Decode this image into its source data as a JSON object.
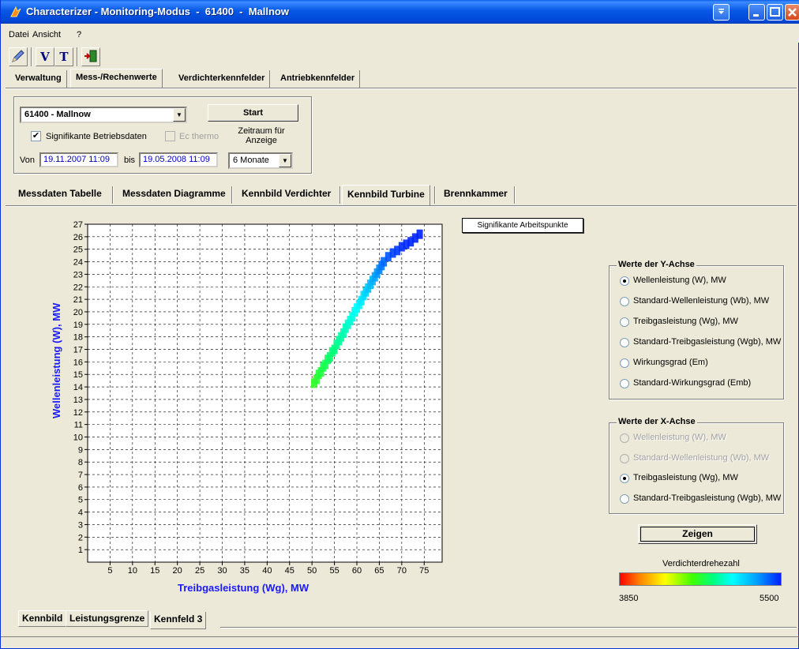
{
  "window": {
    "title": "Characterizer - Monitoring-Modus  -  61400  -  Mallnow"
  },
  "menu": [
    "Datei",
    "Ansicht",
    "?"
  ],
  "toolbar": {
    "v_label": "V",
    "t_label": "T"
  },
  "main_tabs": [
    "Verwaltung",
    "Mess-/Rechenwerte",
    "Verdichterkennfelder",
    "Antriebkennfelder"
  ],
  "controls": {
    "station_select": "61400  -  Mallnow",
    "start_button": "Start",
    "significant_label": "Signifikante Betriebsdaten",
    "significant_checked": true,
    "ec_thermo_label": "Ec thermo",
    "ec_thermo_checked": false,
    "period_label": "Zeitraum für Anzeige",
    "from_label": "Von",
    "from_value": "19.11.2007 11:09",
    "to_label": "bis",
    "to_value": "19.05.2008 11:09",
    "period_select": "6 Monate"
  },
  "sub_tabs": [
    "Messdaten Tabelle",
    "Messdaten Diagramme",
    "Kennbild Verdichter",
    "Kennbild Turbine",
    "Brennkammer"
  ],
  "sig_button": "Signifikante Arbeitspunkte",
  "y_group": {
    "title": "Werte der Y-Achse",
    "options": [
      {
        "label": "Wellenleistung (W), MW",
        "selected": true,
        "enabled": true
      },
      {
        "label": "Standard-Wellenleistung (Wb), MW",
        "selected": false,
        "enabled": true
      },
      {
        "label": "Treibgasleistung (Wg), MW",
        "selected": false,
        "enabled": true
      },
      {
        "label": "Standard-Treibgasleistung (Wgb), MW",
        "selected": false,
        "enabled": true
      },
      {
        "label": "Wirkungsgrad (Em)",
        "selected": false,
        "enabled": true
      },
      {
        "label": "Standard-Wirkungsgrad (Emb)",
        "selected": false,
        "enabled": true
      }
    ]
  },
  "x_group": {
    "title": "Werte der X-Achse",
    "options": [
      {
        "label": "Wellenleistung (W), MW",
        "selected": false,
        "enabled": false
      },
      {
        "label": "Standard-Wellenleistung (Wb), MW",
        "selected": false,
        "enabled": false
      },
      {
        "label": "Treibgasleistung (Wg), MW",
        "selected": true,
        "enabled": true
      },
      {
        "label": "Standard-Treibgasleistung (Wgb), MW",
        "selected": false,
        "enabled": true
      }
    ]
  },
  "show_button": "Zeigen",
  "colorbar": {
    "title": "Verdichterdrehezahl",
    "min": "3850",
    "max": "5500"
  },
  "bottom_tabs": [
    "Kennbild",
    "Leistungsgrenze",
    "Kennfeld 3"
  ],
  "chart_data": {
    "type": "scatter",
    "xlabel": "Treibgasleistung (Wg), MW",
    "ylabel": "Wellenleistung (W), MW",
    "xlim": [
      0,
      79
    ],
    "ylim": [
      0,
      27
    ],
    "xticks": [
      5,
      10,
      15,
      20,
      25,
      30,
      35,
      40,
      45,
      50,
      55,
      60,
      65,
      70,
      75
    ],
    "yticks": [
      1,
      2,
      3,
      4,
      5,
      6,
      7,
      8,
      9,
      10,
      11,
      12,
      13,
      14,
      15,
      16,
      17,
      18,
      19,
      20,
      21,
      22,
      23,
      24,
      25,
      26,
      27
    ],
    "grid": true,
    "color_scale": {
      "min": 3850,
      "max": 5500
    },
    "points": [
      [
        50.5,
        14.3,
        4650
      ],
      [
        51,
        14.6,
        4660
      ],
      [
        51.5,
        15.0,
        4680
      ],
      [
        52,
        15.2,
        4700
      ],
      [
        52.5,
        15.6,
        4720
      ],
      [
        53,
        15.8,
        4730
      ],
      [
        53.5,
        16.2,
        4750
      ],
      [
        54,
        16.4,
        4770
      ],
      [
        54.5,
        16.8,
        4790
      ],
      [
        55,
        17.0,
        4800
      ],
      [
        55.5,
        17.4,
        4820
      ],
      [
        56,
        17.7,
        4840
      ],
      [
        56.5,
        18.0,
        4860
      ],
      [
        57,
        18.3,
        4880
      ],
      [
        57.5,
        18.7,
        4900
      ],
      [
        58,
        19.0,
        4920
      ],
      [
        58.5,
        19.3,
        4940
      ],
      [
        59,
        19.6,
        4960
      ],
      [
        59.5,
        20.0,
        4980
      ],
      [
        60,
        20.3,
        5000
      ],
      [
        60.5,
        20.6,
        5030
      ],
      [
        61,
        20.9,
        5060
      ],
      [
        61.5,
        21.3,
        5090
      ],
      [
        62,
        21.6,
        5120
      ],
      [
        62.5,
        21.9,
        5150
      ],
      [
        63,
        22.2,
        5180
      ],
      [
        63.5,
        22.5,
        5210
      ],
      [
        64,
        22.8,
        5240
      ],
      [
        64.5,
        23.1,
        5270
      ],
      [
        65,
        23.4,
        5300
      ],
      [
        65.5,
        23.7,
        5330
      ],
      [
        66,
        24.0,
        5360
      ],
      [
        67,
        24.4,
        5400
      ],
      [
        68,
        24.7,
        5430
      ],
      [
        69,
        24.9,
        5450
      ],
      [
        70,
        25.2,
        5470
      ],
      [
        71,
        25.4,
        5480
      ],
      [
        72,
        25.6,
        5490
      ],
      [
        73,
        25.9,
        5495
      ],
      [
        74,
        26.2,
        5500
      ]
    ]
  }
}
